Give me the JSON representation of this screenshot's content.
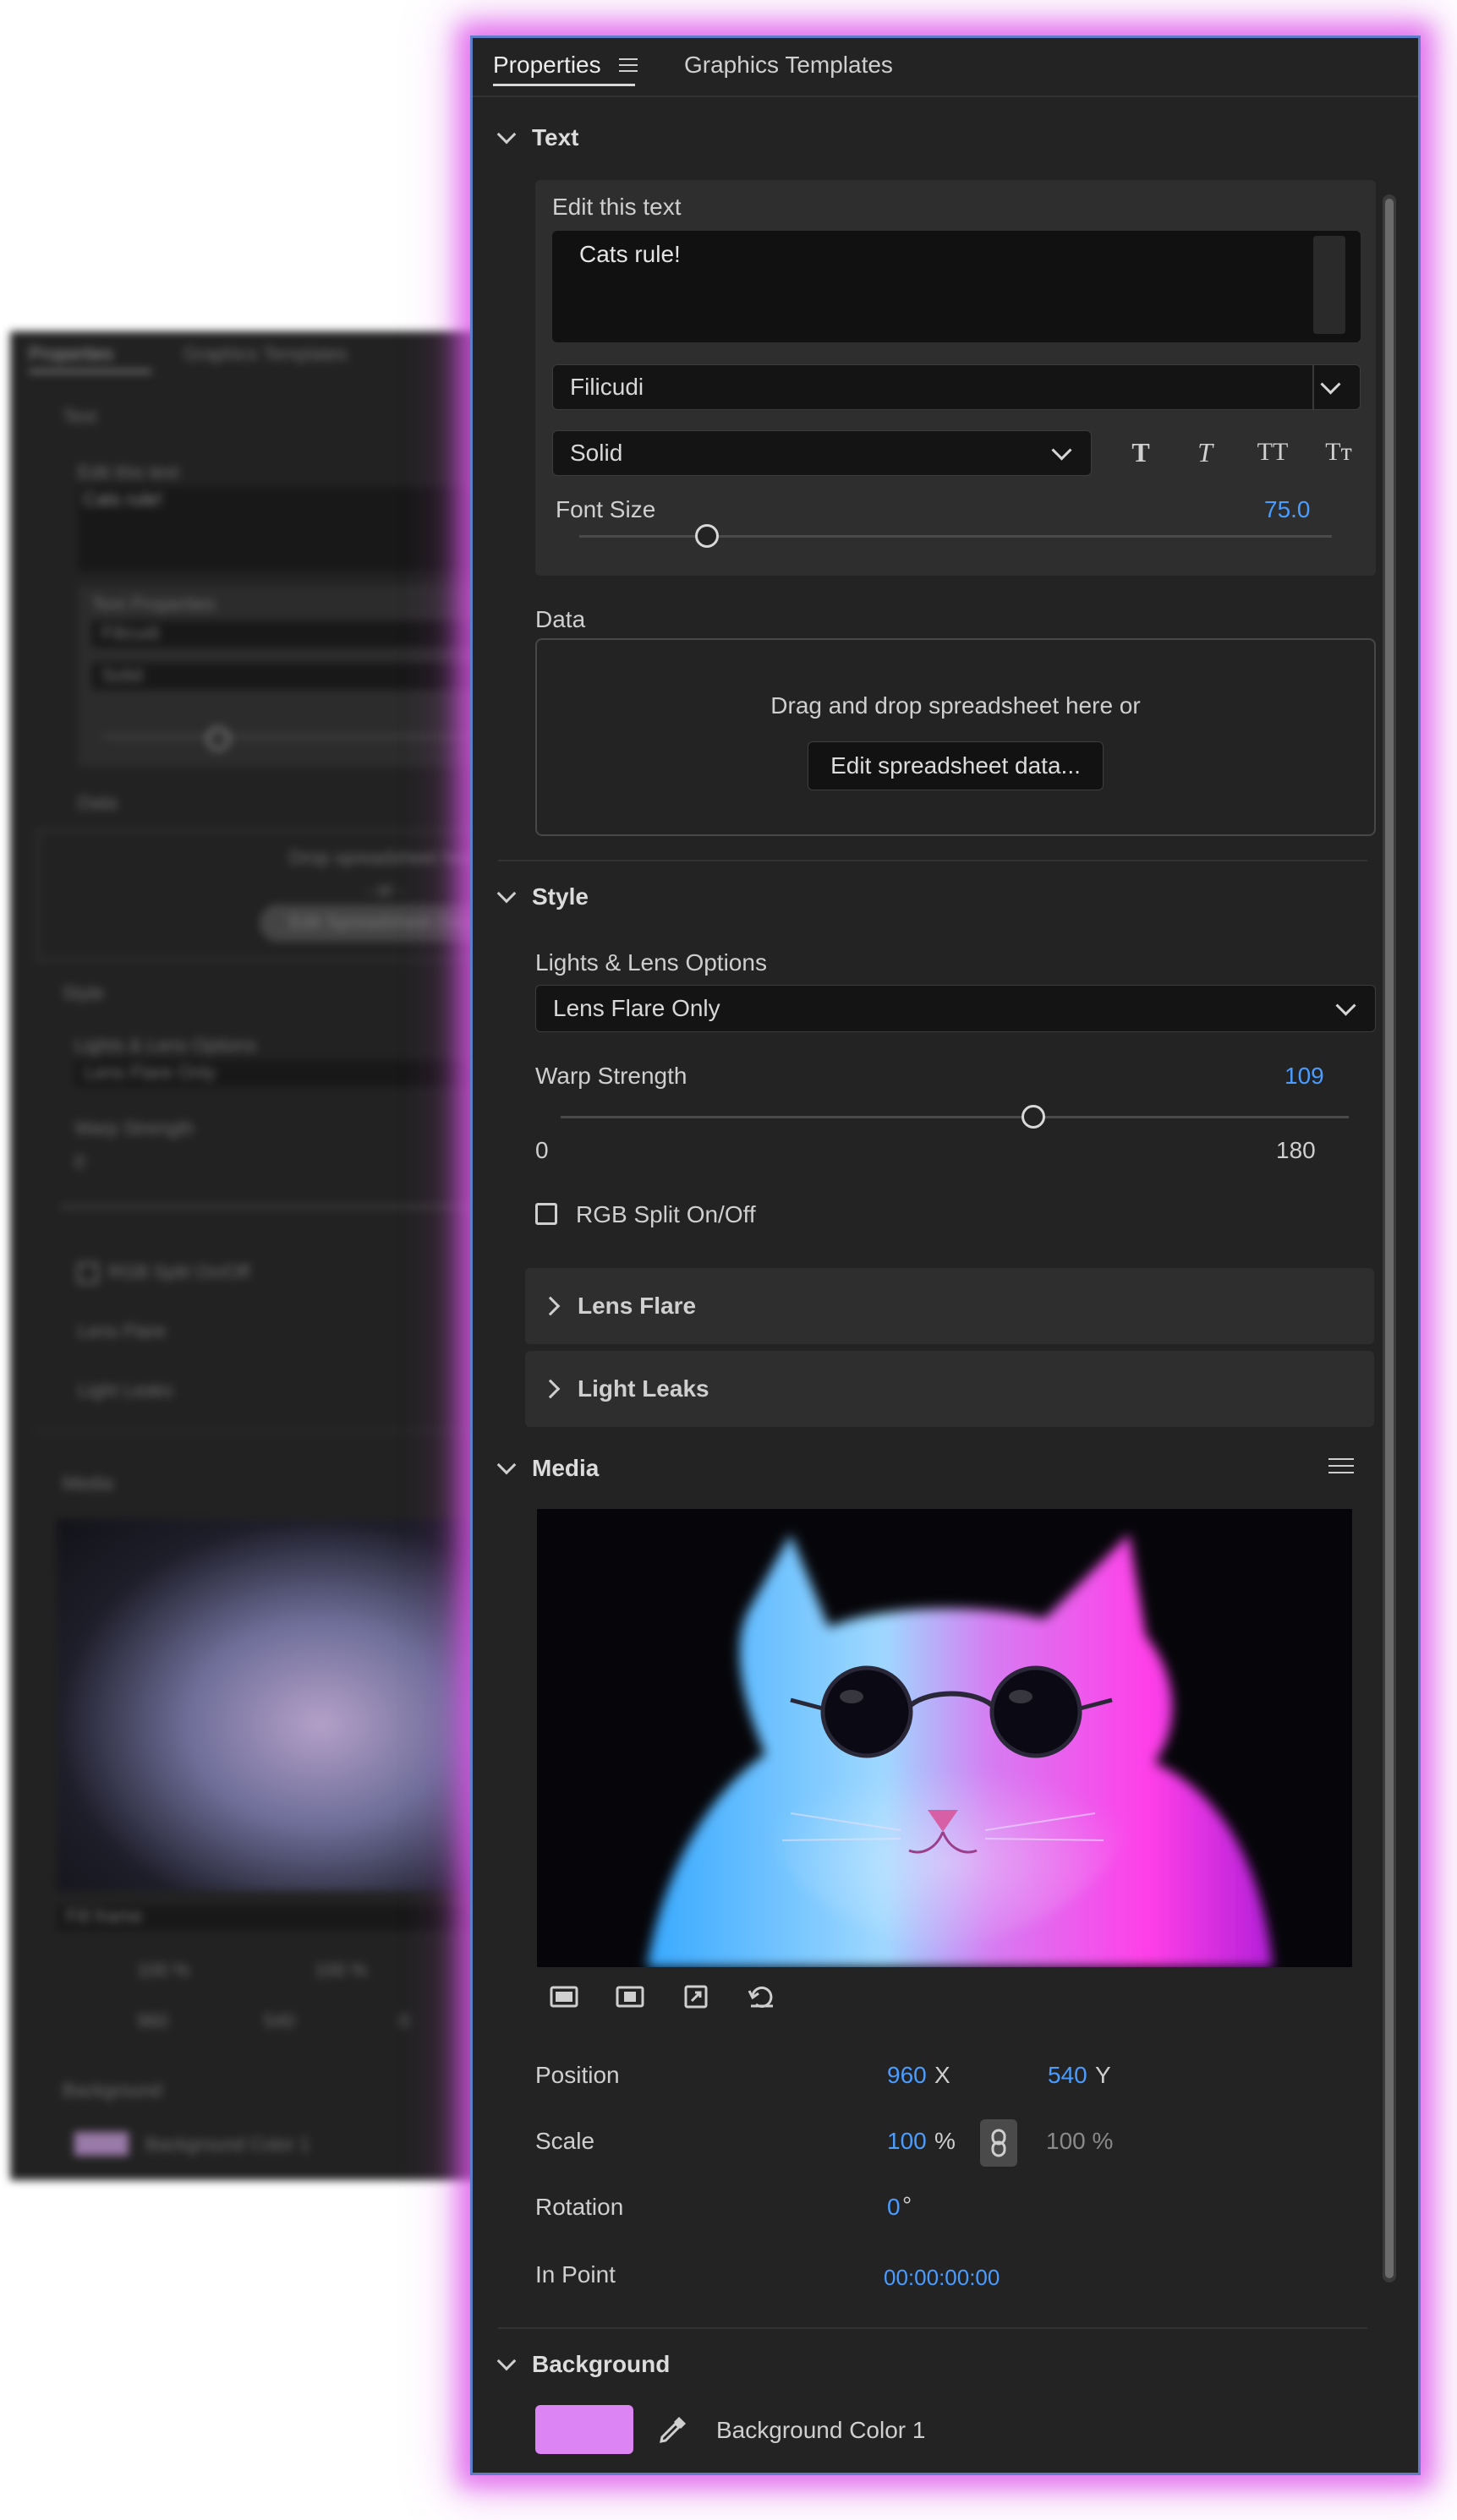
{
  "tabs": {
    "properties": "Properties",
    "graphics_templates": "Graphics Templates"
  },
  "text_section": {
    "title": "Text",
    "edit_label": "Edit this text",
    "text_value": "Cats rule!",
    "font": "Filicudi",
    "style": "Solid",
    "style_buttons": [
      "T",
      "T",
      "TT",
      "Tт"
    ],
    "font_size_label": "Font Size",
    "font_size_value": "75.0",
    "font_size_fraction": 0.17
  },
  "data_section": {
    "title": "Data",
    "drop_text": "Drag and drop spreadsheet here or",
    "edit_button": "Edit spreadsheet data..."
  },
  "style_section": {
    "title": "Style",
    "lights_label": "Lights & Lens Options",
    "lights_value": "Lens Flare Only",
    "warp_label": "Warp Strength",
    "warp_value": "109",
    "warp_min": "0",
    "warp_max": "180",
    "warp_fraction": 0.6,
    "rgb_split_label": "RGB Split On/Off",
    "lens_flare": "Lens Flare",
    "light_leaks": "Light Leaks"
  },
  "media_section": {
    "title": "Media",
    "position_label": "Position",
    "position_x": "960",
    "position_x_unit": "X",
    "position_y": "540",
    "position_y_unit": "Y",
    "scale_label": "Scale",
    "scale_value": "100",
    "scale_unit": "%",
    "scale_linked": "100 %",
    "rotation_label": "Rotation",
    "rotation_value": "0",
    "rotation_unit": "°",
    "in_point_label": "In Point",
    "in_point_value": "00:00:00:00"
  },
  "background_section": {
    "title": "Background",
    "color_label": "Background Color 1",
    "color_hex": "#dc84f4"
  },
  "ghost": {
    "tab1": "Properties",
    "tab2": "Graphics Templates",
    "text": "Text",
    "edit": "Edit this text",
    "value": "Cats rule!",
    "text_props": "Text Properties",
    "font": "Filicudi",
    "style": "Solid",
    "data": "Data",
    "drop": "Drop spreadsheet here",
    "or": "- or -",
    "edit_sheet": "Edit Spreadsheet Data",
    "style_title": "Style",
    "lights": "Lights & Lens Options",
    "lights_val": "Lens Flare Only",
    "warp": "Warp Strength",
    "warp_val": "0",
    "rgb": "RGB Split On/Off",
    "lens": "Lens Flare",
    "leaks": "Light Leaks",
    "media": "Media",
    "fill": "Fill frame",
    "h_val": "100 %",
    "w_val": "100 %",
    "x_val": "960",
    "y_val": "540",
    "rot_val": "0",
    "background": "Background",
    "bg_color": "Background Color 1"
  }
}
